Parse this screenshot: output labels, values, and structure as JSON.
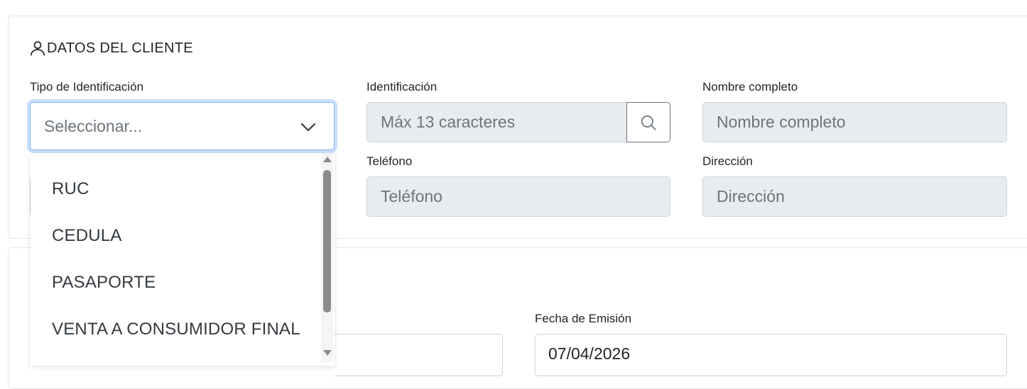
{
  "client_section": {
    "title": "DATOS DEL CLIENTE",
    "tipo_identificacion": {
      "label": "Tipo de Identificación",
      "selected": "Seleccionar...",
      "options": [
        "RUC",
        "CEDULA",
        "PASAPORTE",
        "VENTA A CONSUMIDOR FINAL"
      ]
    },
    "identificacion": {
      "label": "Identificación",
      "placeholder": "Máx 13 caracteres"
    },
    "nombre": {
      "label": "Nombre completo",
      "placeholder": "Nombre completo"
    },
    "telefono": {
      "label": "Teléfono",
      "placeholder": "Teléfono"
    },
    "direccion": {
      "label": "Dirección",
      "placeholder": "Dirección"
    }
  },
  "invoice_section": {
    "fecha_emision": {
      "label": "Fecha de Emisión",
      "value": "07/04/2026"
    }
  },
  "icons": {
    "section": "user-icon",
    "select": "chevron-down-icon",
    "search": "search-icon"
  },
  "colors": {
    "focus_border": "#86b7fe",
    "disabled_bg": "#e9ecef",
    "placeholder": "#6c757d"
  }
}
